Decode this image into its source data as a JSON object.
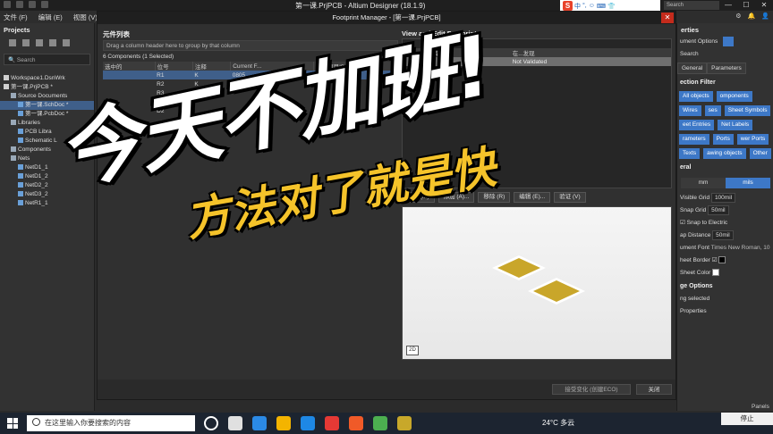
{
  "titlebar": {
    "app_title": "第一课.PrjPCB - Altium Designer (18.1.9)",
    "ime_items": [
      "中",
      "°,",
      "☺",
      "⌨",
      "👕"
    ],
    "search": "Search",
    "controls": [
      "—",
      "☐",
      "✕"
    ]
  },
  "menubar": {
    "items": [
      "文件 (F)",
      "编辑 (E)",
      "视图 (V)",
      "工"
    ]
  },
  "projects": {
    "title": "Projects",
    "search_placeholder": "Search",
    "tree": [
      {
        "label": "Workspace1.DsnWrk",
        "level": 0,
        "selected": false
      },
      {
        "label": "第一课.PrjPCB *",
        "level": 0,
        "selected": false
      },
      {
        "label": "Source Documents",
        "level": 1,
        "selected": false
      },
      {
        "label": "第一课.SchDoc *",
        "level": 2,
        "selected": true
      },
      {
        "label": "第一课.PcbDoc *",
        "level": 2,
        "selected": false
      },
      {
        "label": "Libraries",
        "level": 1,
        "selected": false
      },
      {
        "label": "PCB Libra",
        "level": 2,
        "selected": false
      },
      {
        "label": "Schematic L",
        "level": 2,
        "selected": false
      },
      {
        "label": "Components",
        "level": 1,
        "selected": false
      },
      {
        "label": "Nets",
        "level": 1,
        "selected": false
      },
      {
        "label": "NetD1_1",
        "level": 2,
        "selected": false
      },
      {
        "label": "NetD1_2",
        "level": 2,
        "selected": false
      },
      {
        "label": "NetD2_2",
        "level": 2,
        "selected": false
      },
      {
        "label": "NetD3_2",
        "level": 2,
        "selected": false
      },
      {
        "label": "NetR1_1",
        "level": 2,
        "selected": false
      }
    ]
  },
  "dialog": {
    "title": "Footprint Manager - [第一课.PrjPCB]",
    "left_title": "元件列表",
    "drag_hint": "Drag a column header here to group by that column",
    "count": "6 Components (1 Selected)",
    "columns": [
      "选中的",
      "位号",
      "注释",
      "Current F...",
      "设计项目ID"
    ],
    "rows": [
      {
        "cells": [
          "",
          "R1",
          "K",
          "0805",
          ""
        ],
        "selected": true
      },
      {
        "cells": [
          "",
          "R2",
          "K",
          "",
          ""
        ],
        "selected": false
      },
      {
        "cells": [
          "",
          "R3",
          "K",
          "",
          ""
        ],
        "selected": false
      },
      {
        "cells": [
          "",
          "D1",
          "",
          "",
          ""
        ],
        "selected": false
      },
      {
        "cells": [
          "",
          "D2",
          "",
          "",
          ""
        ],
        "selected": false
      }
    ],
    "right_title": "View and Edit Footprints",
    "right_sub": "elected)",
    "fp_columns": [
      "",
      "PCB库",
      "在...发现"
    ],
    "fp_rows": [
      [
        "",
        "Any",
        "Not Validated"
      ]
    ],
    "buttons": [
      "菜单 (M)",
      "添加 (A)...",
      "移除 (R)",
      "编辑 (E)...",
      "验证 (V)"
    ],
    "view_2d": "2D",
    "bottom_accept": "接受变化 (创建ECO)",
    "bottom_close": "关闭"
  },
  "props": {
    "title": "erties",
    "doc_options": "ument Options",
    "search": "Search",
    "tabs": [
      "General",
      "Parameters"
    ],
    "selection_filter": "ection Filter",
    "chips": [
      "All objects",
      "omponents",
      "Wires",
      "ses",
      "Sheet Symbols",
      "eet Entries",
      "Net Labels",
      "rameters",
      "Ports",
      "wer Ports",
      "Texts",
      "awing objects",
      "Other"
    ],
    "general": "eral",
    "units": [
      "mm",
      "mils"
    ],
    "visible_grid_label": "Visible Grid",
    "visible_grid": "100mil",
    "snap_grid_label": "Snap Grid",
    "snap_grid": "50mil",
    "snap_electric": "Snap to Electric",
    "snap_distance_label": "ap Distance",
    "snap_distance": "50mil",
    "font_label": "ument Font",
    "font_value": "Times New Roman, 10",
    "sheet_border": "heet Border",
    "sheet_color": "Sheet Color",
    "page_options": "ge Options",
    "selected": "ng selected",
    "properties": "Properties"
  },
  "overlay": {
    "headline": "今天不加班!",
    "subline": "方法对了就是快"
  },
  "taskbar": {
    "search_text": "在这里输入你要搜索的内容",
    "weather": "24°C  多云",
    "stop": "停止",
    "panels": "Panels",
    "app_colors": [
      "#ffffff",
      "#e0e0e0",
      "#2b8ae6",
      "#f4b400",
      "#1e88e5",
      "#e53935",
      "#f05a28",
      "#4caf50",
      "#c8a82a"
    ]
  },
  "colors": {
    "accent": "#3d78c7",
    "pad": "#c9a62a",
    "close": "#c42b1c",
    "overlay_sub": "#f5c32a"
  }
}
